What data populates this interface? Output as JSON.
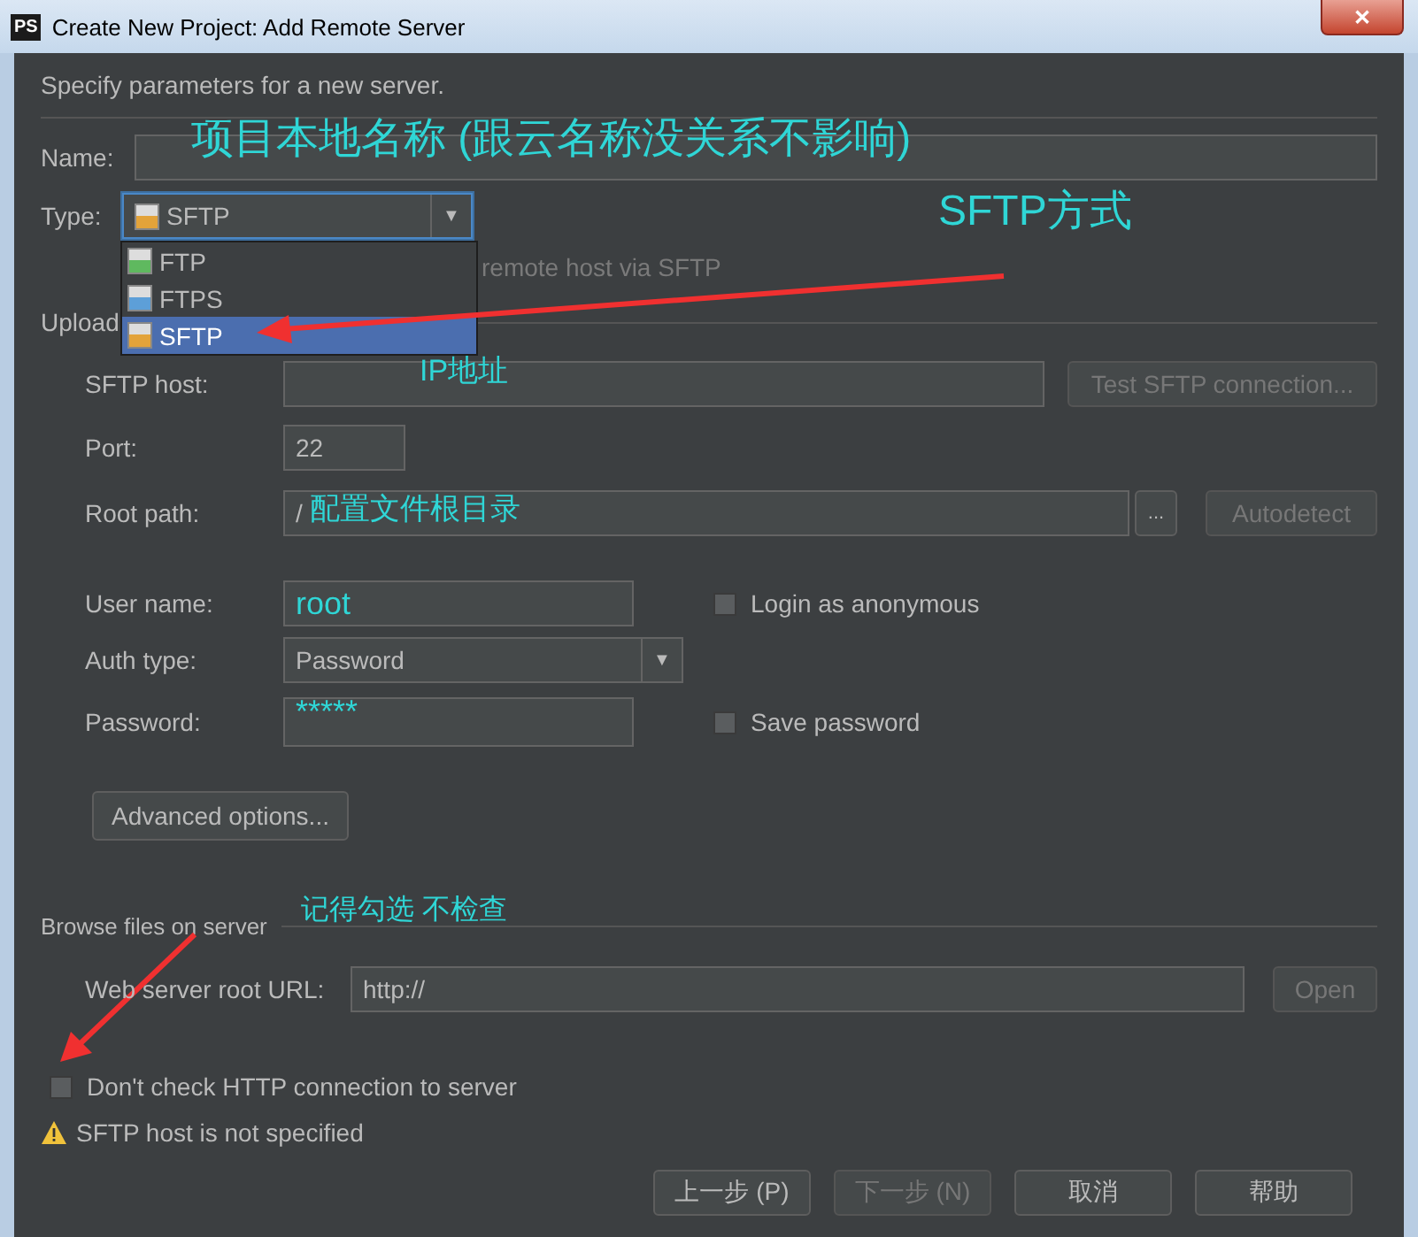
{
  "window": {
    "title": "Create New Project: Add Remote Server",
    "app_badge": "PS",
    "close": "✕"
  },
  "intro": "Specify parameters for a new server.",
  "name_field": {
    "label": "Name:"
  },
  "type_field": {
    "label": "Type:",
    "value": "SFTP",
    "arrow": "▼",
    "expanded": true,
    "options": [
      {
        "label": "FTP",
        "selected": false,
        "color": "#5fb95f"
      },
      {
        "label": "FTPS",
        "selected": false,
        "color": "#5d9fd8"
      },
      {
        "label": "SFTP",
        "selected": true,
        "color": "#e3a33a"
      }
    ]
  },
  "type_hint": "remote host via SFTP",
  "upload_section": {
    "title": "Upload"
  },
  "host_field": {
    "label": "SFTP host:",
    "button": "Test SFTP connection..."
  },
  "port_field": {
    "label": "Port:",
    "value": "22"
  },
  "root_field": {
    "label": "Root path:",
    "value": "/",
    "browse": "...",
    "button": "Autodetect"
  },
  "user_field": {
    "label": "User name:",
    "value": "root",
    "checkbox": {
      "label": "Login as anonymous",
      "checked": false
    }
  },
  "auth_field": {
    "label": "Auth type:",
    "value": "Password",
    "arrow": "▼"
  },
  "password_field": {
    "label": "Password:",
    "value": "*****",
    "checkbox": {
      "label": "Save password",
      "checked": false
    }
  },
  "advanced_button": "Advanced options...",
  "browse_section": {
    "title": "Browse files on server"
  },
  "web_field": {
    "label": "Web server root URL:",
    "value": "http://",
    "button": "Open"
  },
  "dont_check": {
    "label": "Don't check HTTP connection to server",
    "checked": false
  },
  "warning": "SFTP host is not specified",
  "buttons": [
    {
      "label": "上一步 (P)",
      "disabled": false
    },
    {
      "label": "下一步 (N)",
      "disabled": true
    },
    {
      "label": "取消",
      "disabled": false
    },
    {
      "label": "帮助",
      "disabled": false
    }
  ],
  "annotations": [
    "项目本地名称 (跟云名称没关系不影响)",
    "SFTP方式",
    "IP地址",
    "配置文件根目录",
    "记得勾选 不检查"
  ]
}
